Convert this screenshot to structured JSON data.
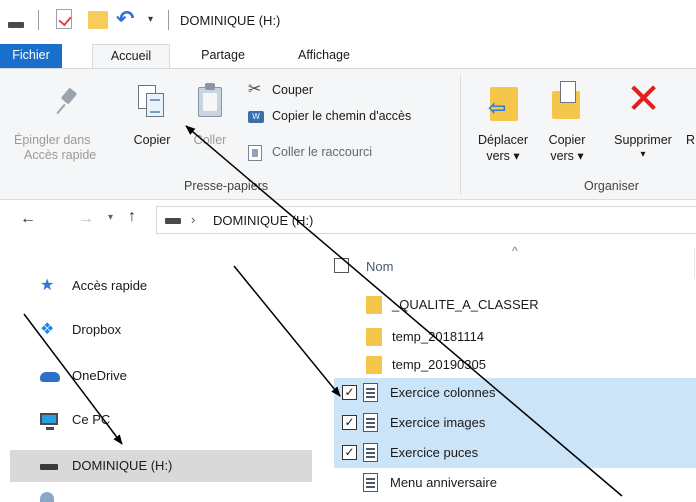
{
  "window": {
    "title": "DOMINIQUE (H:)",
    "quick_access": {
      "dropdown_glyph": "▾"
    }
  },
  "tabs": [
    "Fichier",
    "Accueil",
    "Partage",
    "Affichage"
  ],
  "ribbon": {
    "pin_line1": "Épingler dans",
    "pin_line2": "Accès rapide",
    "copy": "Copier",
    "paste": "Coller",
    "cut": "Couper",
    "copy_path": "Copier le chemin d'accès",
    "paste_shortcut": "Coller le raccourci",
    "group_clipboard": "Presse-papiers",
    "move_line1": "Déplacer",
    "move_line2": "vers ▾",
    "copyto_line1": "Copier",
    "copyto_line2": "vers ▾",
    "delete": "Supprimer",
    "delete_dd": "▾",
    "rename_partial": "R",
    "group_organize": "Organiser"
  },
  "address": {
    "path": "DOMINIQUE (H:)",
    "chevron": "›"
  },
  "sidebar": {
    "items": [
      {
        "label": "Accès rapide",
        "icon": "star-icon"
      },
      {
        "label": "Dropbox",
        "icon": "dropbox-icon"
      },
      {
        "label": "OneDrive",
        "icon": "cloud-icon"
      },
      {
        "label": "Ce PC",
        "icon": "computer-icon"
      },
      {
        "label": "DOMINIQUE (H:)",
        "icon": "drive-icon",
        "selected": true
      }
    ]
  },
  "filelist": {
    "column_name": "Nom",
    "sort_glyph": "^",
    "items": [
      {
        "name": "_QUALITE_A_CLASSER",
        "type": "folder",
        "selected": false
      },
      {
        "name": "temp_20181114",
        "type": "folder",
        "selected": false
      },
      {
        "name": "temp_20190305",
        "type": "folder",
        "selected": false
      },
      {
        "name": "Exercice colonnes",
        "type": "document",
        "selected": true,
        "checked": "✓"
      },
      {
        "name": "Exercice images",
        "type": "document",
        "selected": true,
        "checked": "✓"
      },
      {
        "name": "Exercice puces",
        "type": "document",
        "selected": true,
        "checked": "✓"
      },
      {
        "name": "Menu anniversaire",
        "type": "document",
        "selected": false
      }
    ]
  },
  "colors": {
    "accent": "#1a6fcc",
    "selection": "#cce4f7",
    "sidebar_selected": "#d9d9d9",
    "folder": "#f6c64a",
    "delete_red": "#e02020"
  }
}
